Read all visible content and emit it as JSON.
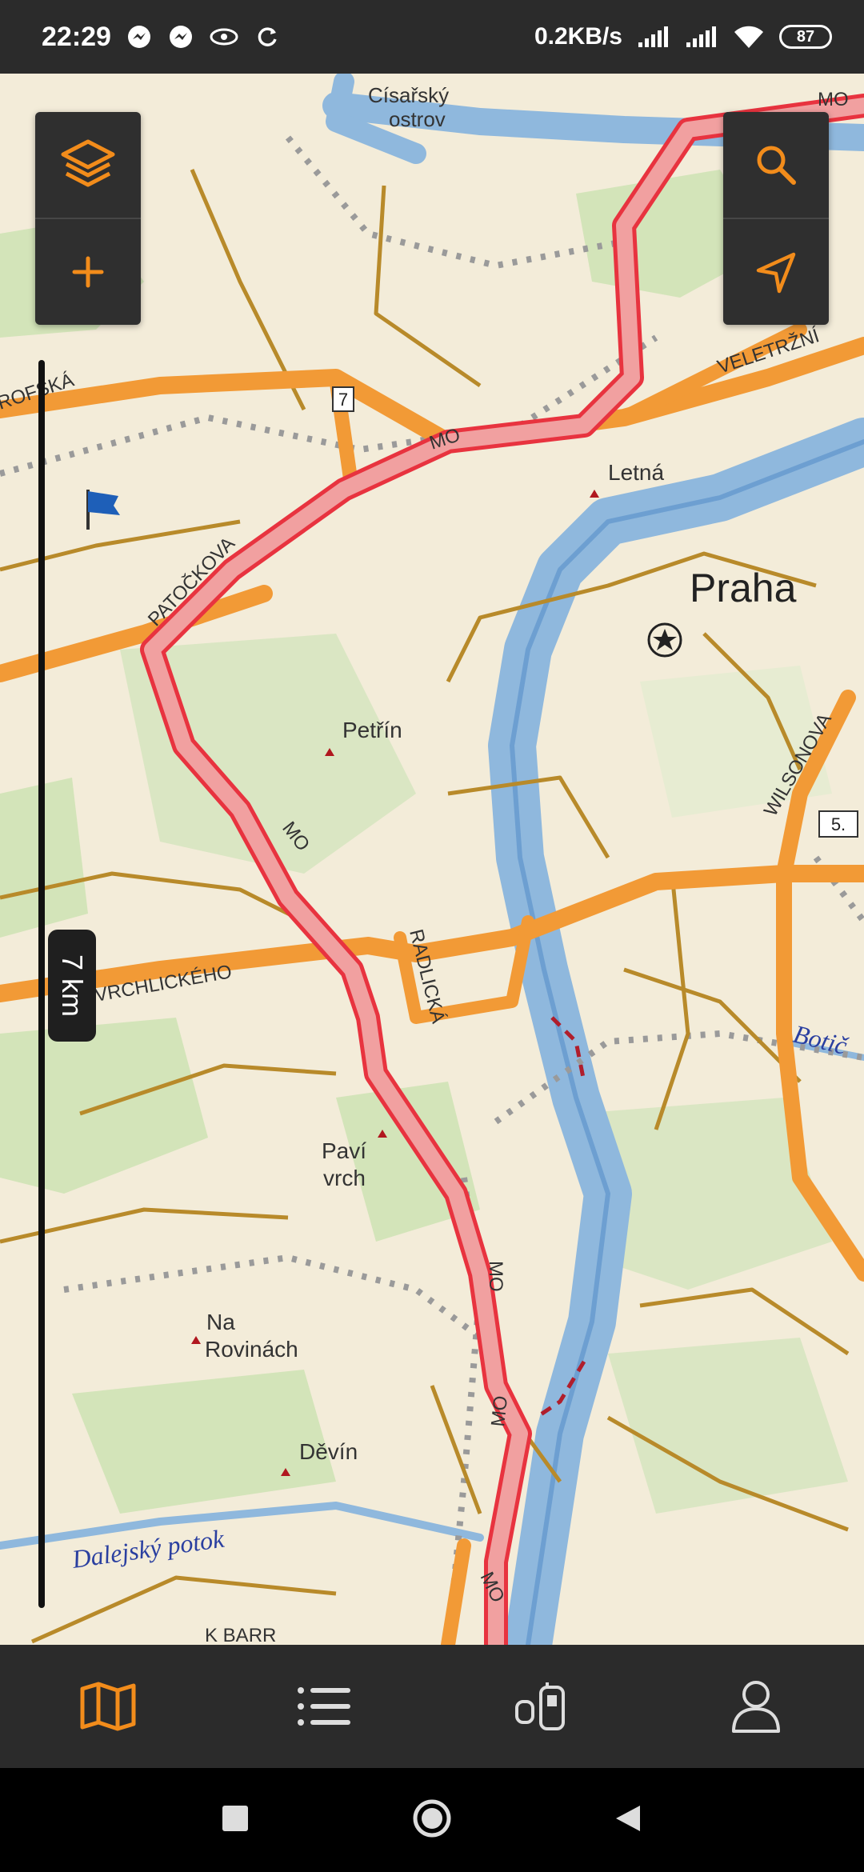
{
  "status_bar": {
    "time": "22:29",
    "net_speed": "0.2KB/s",
    "battery": "87",
    "icons": [
      "messenger-icon",
      "messenger-icon",
      "eye-icon",
      "sync-icon",
      "signal-icon",
      "signal-icon",
      "wifi-icon"
    ]
  },
  "map": {
    "labels": {
      "cisarsky": "Císařský",
      "ostrov": "ostrov",
      "mo_top": "MO",
      "veletrzni": "VELETRŽNÍ",
      "rofska": "ROFSKÁ",
      "road7": "7",
      "mo_1": "MO",
      "letna": "Letná",
      "patockova": "PATOČKOVA",
      "praha": "Praha",
      "petrin": "Petřín",
      "wilsonova": "WILSONOVA",
      "mo_2": "MO",
      "vrchlickeho": "VRCHLICKÉHO",
      "radlicka": "RADLICKÁ",
      "botic": "Botič",
      "pavi": "Paví",
      "vrch": "vrch",
      "road5": "5.",
      "mo_3": "MO",
      "na": "Na",
      "rovinach": "Rovinách",
      "devin": "Děvín",
      "mo_4": "MO",
      "dalejsky": "Dalejský potok",
      "mo_5": "MO",
      "k_barr": "K BARR"
    },
    "colors": {
      "background": "#f3ecd9",
      "road_major": "#f29a36",
      "road_minor": "#b88a2a",
      "water": "#8fb8dd",
      "water_edge": "#6d9fd1",
      "forest": "#cfe3b5",
      "route": "#e8333f",
      "route_fill": "#f1a0a0"
    }
  },
  "map_controls": {
    "layers": "layers-icon",
    "zoom_in": "plus-icon",
    "search": "search-icon",
    "locate": "navigation-arrow-icon"
  },
  "scale": {
    "label": "7 km"
  },
  "bottom_nav": {
    "items": [
      "map-icon",
      "list-icon",
      "devices-icon",
      "profile-icon"
    ],
    "active": "map-icon",
    "accent": "#f28c1b"
  },
  "system_nav": {
    "items": [
      "recents-icon",
      "home-icon",
      "back-icon"
    ]
  }
}
